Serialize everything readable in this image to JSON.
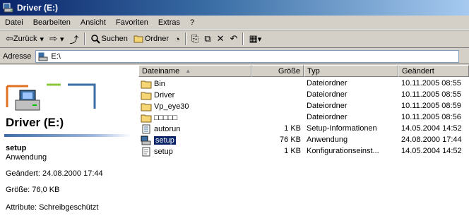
{
  "window": {
    "title": "Driver (E:)"
  },
  "menu": [
    "Datei",
    "Bearbeiten",
    "Ansicht",
    "Favoriten",
    "Extras",
    "?"
  ],
  "toolbar": {
    "back": "Zurück",
    "back_arrow": "⇦",
    "forward_arrow": "⇨",
    "dropdown": "▾",
    "up": "⤴",
    "search": "Suchen",
    "folders": "Ordner",
    "history": "◔",
    "move": "⎘",
    "copy": "⧉",
    "delete": "✕",
    "undo": "↶",
    "views": "▦"
  },
  "address": {
    "label": "Adresse",
    "value": "E:\\"
  },
  "left_pane": {
    "drive_title": "Driver (E:)",
    "selected_name": "setup",
    "selected_type": "Anwendung",
    "modified": "Geändert: 24.08.2000 17:44",
    "size": "Größe: 76,0 KB",
    "attributes": "Attribute: Schreibgeschützt"
  },
  "columns": {
    "name": "Dateiname",
    "sort_indicator": "▲",
    "size": "Größe",
    "type": "Typ",
    "date": "Geändert"
  },
  "files": [
    {
      "name": "Bin",
      "size": "",
      "type": "Dateiordner",
      "date": "10.11.2005 08:55",
      "icon": "folder-icon"
    },
    {
      "name": "Driver",
      "size": "",
      "type": "Dateiordner",
      "date": "10.11.2005 08:55",
      "icon": "folder-icon"
    },
    {
      "name": "Vp_eye30",
      "size": "",
      "type": "Dateiordner",
      "date": "10.11.2005 08:59",
      "icon": "folder-icon"
    },
    {
      "name": "□□□□□",
      "size": "",
      "type": "Dateiordner",
      "date": "10.11.2005 08:56",
      "icon": "folder-icon"
    },
    {
      "name": "autorun",
      "size": "1 KB",
      "type": "Setup-Informationen",
      "date": "14.05.2004 14:52",
      "icon": "inf-file-icon"
    },
    {
      "name": "setup",
      "size": "76 KB",
      "type": "Anwendung",
      "date": "24.08.2000 17:44",
      "icon": "application-icon",
      "selected": true
    },
    {
      "name": "setup",
      "size": "1 KB",
      "type": "Konfigurationseinst...",
      "date": "14.05.2004 14:52",
      "icon": "config-file-icon"
    }
  ],
  "colors": {
    "title_start": "#0a246a",
    "title_end": "#a6caf0",
    "selection": "#0a246a",
    "folder": "#f4d675"
  }
}
